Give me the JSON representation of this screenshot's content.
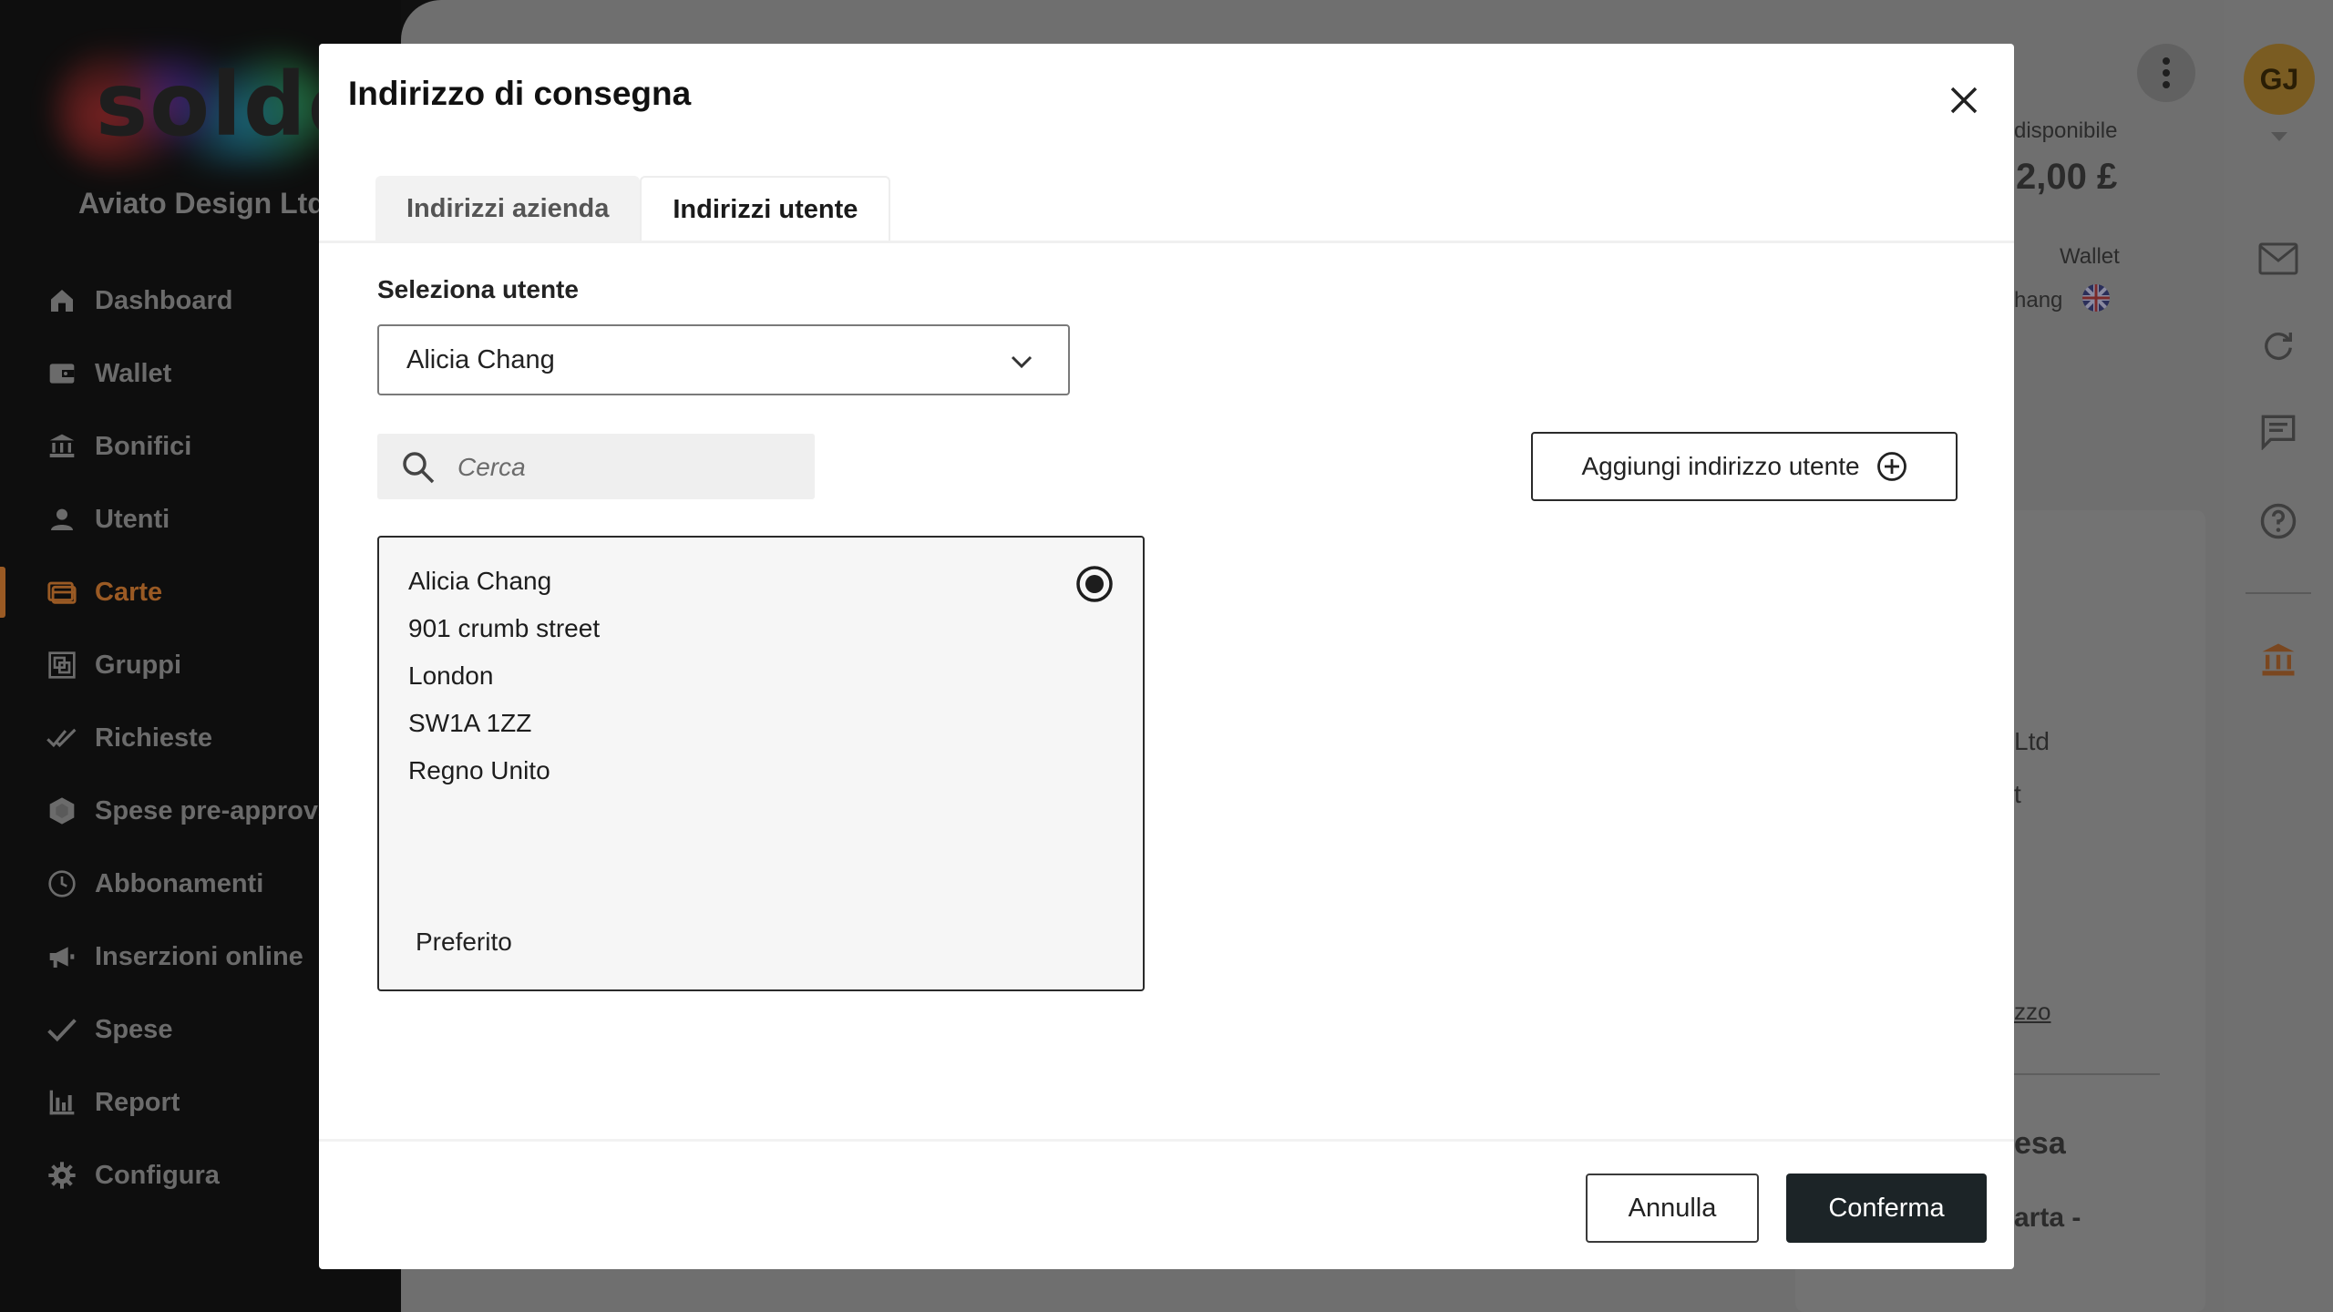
{
  "sidebar": {
    "logo": "soldo",
    "company": "Aviato Design Ltd",
    "items": [
      {
        "label": "Dashboard",
        "icon": "home-icon"
      },
      {
        "label": "Wallet",
        "icon": "wallet-icon"
      },
      {
        "label": "Bonifici",
        "icon": "bank-transfer-icon"
      },
      {
        "label": "Utenti",
        "icon": "user-icon"
      },
      {
        "label": "Carte",
        "icon": "card-icon",
        "active": true
      },
      {
        "label": "Gruppi",
        "icon": "groups-icon"
      },
      {
        "label": "Richieste",
        "icon": "double-check-icon"
      },
      {
        "label": "Spese pre-approvate",
        "icon": "hexagon-icon"
      },
      {
        "label": "Abbonamenti",
        "icon": "clock-icon"
      },
      {
        "label": "Inserzioni online",
        "icon": "megaphone-icon"
      },
      {
        "label": "Spese",
        "icon": "check-icon"
      },
      {
        "label": "Report",
        "icon": "bar-chart-icon"
      },
      {
        "label": "Configura",
        "icon": "gear-icon"
      }
    ]
  },
  "background": {
    "available_label": "disponibile",
    "available_amount": "2,00 £",
    "wallet_label": "Wallet",
    "wallet_owner": "hang",
    "ltd_fragment": "Ltd",
    "t_fragment": "t",
    "zzo_fragment": "zzo",
    "esa_fragment": "esa",
    "arta_fragment": "arta -",
    "avatar_initials": "GJ"
  },
  "modal": {
    "title": "Indirizzo di consegna",
    "tabs": [
      {
        "label": "Indirizzi azienda",
        "active": false
      },
      {
        "label": "Indirizzi utente",
        "active": true
      }
    ],
    "select_label": "Seleziona utente",
    "selected_user": "Alicia Chang",
    "search_placeholder": "Cerca",
    "add_button": "Aggiungi indirizzo utente",
    "address": {
      "name": "Alicia Chang",
      "street": "901 crumb street",
      "city": "London",
      "postcode": "SW1A 1ZZ",
      "country": "Regno Unito",
      "tag": "Preferito"
    },
    "cancel": "Annulla",
    "confirm": "Conferma"
  },
  "colors": {
    "accent": "#9a5a24",
    "primary_button": "#1c2427"
  }
}
